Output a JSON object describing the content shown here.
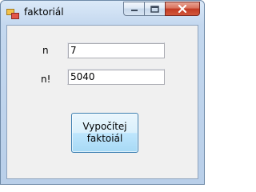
{
  "window": {
    "title": "faktoriál",
    "icons": {
      "app": "app-form-icon",
      "minimize": "minimize-icon",
      "maximize": "maximize-icon",
      "close": "close-icon"
    }
  },
  "form": {
    "n_label": "n",
    "n_value": "7",
    "result_label": "n!",
    "result_value": "5040",
    "compute_button": "Vypočítej\nfaktoiál"
  }
}
